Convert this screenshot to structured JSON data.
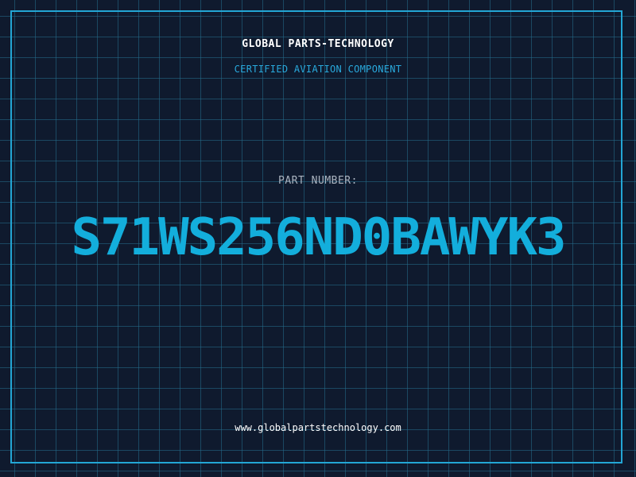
{
  "header": {
    "company_name": "GLOBAL PARTS-TECHNOLOGY",
    "tagline": "CERTIFIED AVIATION COMPONENT"
  },
  "part": {
    "label": "PART NUMBER:",
    "number": "S71WS256ND0BAWYK3"
  },
  "footer": {
    "website": "www.globalpartstechnology.com"
  },
  "colors": {
    "background": "#0f1a2e",
    "grid": "#246e8c",
    "accent": "#13aedc",
    "frame": "#23a6d5"
  }
}
